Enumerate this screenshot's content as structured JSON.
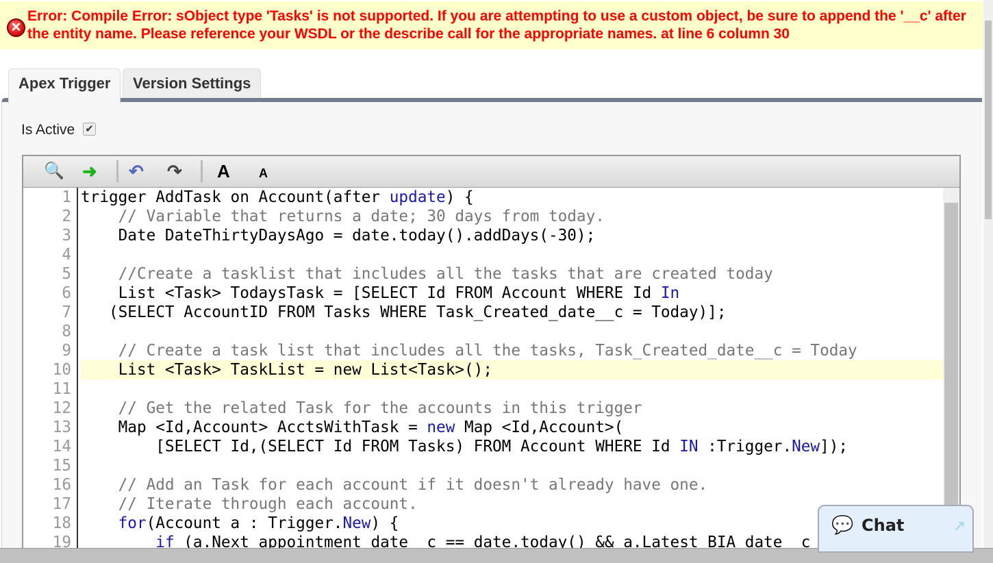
{
  "error": {
    "message": "Error: Compile Error: sObject type 'Tasks' is not supported. If you are attempting to use a custom object, be sure to append the '__c' after the entity name. Please reference your WSDL or the describe call for the appropriate names. at line 6 column 30"
  },
  "tabs": [
    {
      "label": "Apex Trigger"
    },
    {
      "label": "Version Settings"
    }
  ],
  "is_active": {
    "label": "Is Active",
    "checked": true
  },
  "toolbar": {
    "large_font": "A",
    "small_font": "A"
  },
  "chat": {
    "label": "Chat"
  },
  "code": {
    "highlighted_line": 10,
    "lines": [
      [
        [
          "trigger AddTask on Account(after ",
          ""
        ],
        [
          "update",
          "kw"
        ],
        [
          ") {",
          ""
        ]
      ],
      [
        [
          "    // Variable that returns a date; 30 days from today.",
          "cm"
        ]
      ],
      [
        [
          "    Date DateThirtyDaysAgo = date.today().addDays(-30);",
          ""
        ]
      ],
      [
        [
          "",
          ""
        ]
      ],
      [
        [
          "    //Create a tasklist that includes all the tasks that are created today",
          "cm"
        ]
      ],
      [
        [
          "    List <Task> TodaysTask = [SELECT Id FROM Account WHERE Id ",
          ""
        ],
        [
          "In",
          "kw"
        ]
      ],
      [
        [
          "   (SELECT AccountID FROM Tasks WHERE Task_Created_date__c = Today)];",
          ""
        ]
      ],
      [
        [
          "",
          ""
        ]
      ],
      [
        [
          "    // Create a task list that includes all the tasks, Task_Created_date__c = Today",
          "cm"
        ]
      ],
      [
        [
          "    List <Task> TaskList = new List<Task>();",
          ""
        ]
      ],
      [
        [
          "",
          ""
        ]
      ],
      [
        [
          "    // Get the related Task for the accounts in this trigger",
          "cm"
        ]
      ],
      [
        [
          "    Map <Id,Account> AcctsWithTask = ",
          ""
        ],
        [
          "new",
          "kw"
        ],
        [
          " Map <Id,Account>(",
          ""
        ]
      ],
      [
        [
          "        [SELECT Id,(SELECT Id FROM Tasks) FROM Account WHERE Id ",
          ""
        ],
        [
          "IN",
          "kw"
        ],
        [
          " :Trigger.",
          ""
        ],
        [
          "New",
          "kw"
        ],
        [
          "]);",
          ""
        ]
      ],
      [
        [
          "",
          ""
        ]
      ],
      [
        [
          "    // Add an Task for each account if it doesn't already have one.",
          "cm"
        ]
      ],
      [
        [
          "    // Iterate through each account.",
          "cm"
        ]
      ],
      [
        [
          "    ",
          ""
        ],
        [
          "for",
          "kw"
        ],
        [
          "(Account a : Trigger.",
          ""
        ],
        [
          "New",
          "kw"
        ],
        [
          ") {",
          ""
        ]
      ],
      [
        [
          "        ",
          ""
        ],
        [
          "if",
          "kw"
        ],
        [
          " (a.Next_appointment_date__c == date.today() && a.Latest_BIA_date__c",
          ""
        ]
      ]
    ]
  }
}
